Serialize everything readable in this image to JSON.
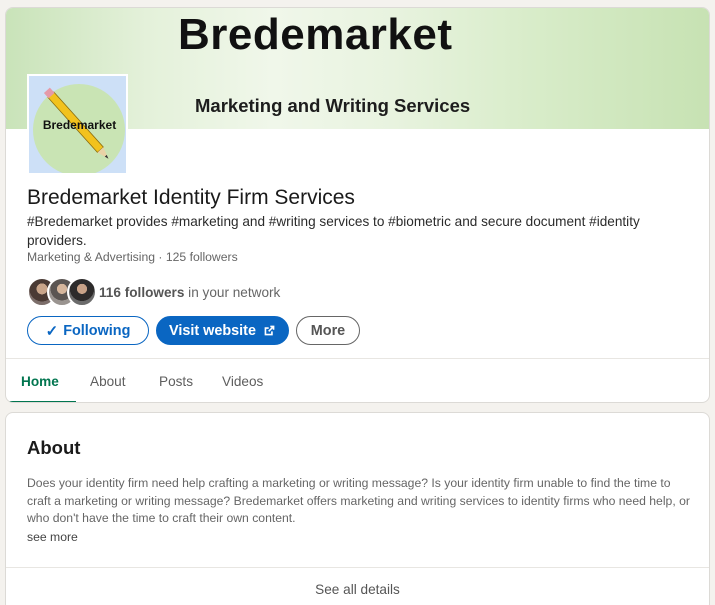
{
  "banner": {
    "title": "Bredemarket",
    "subtitle": "Marketing and Writing Services"
  },
  "logo": {
    "text": "Bredemarket",
    "icon": "pencil-icon"
  },
  "company": {
    "name": "Bredemarket Identity Firm Services",
    "tagline": "#Bredemarket provides #marketing and #writing services to #biometric and secure document #identity providers.",
    "meta": "Marketing & Advertising · 125 followers"
  },
  "network": {
    "followers_count": "116 followers",
    "suffix": " in your network"
  },
  "actions": {
    "following_label": "Following",
    "visit_label": "Visit website",
    "more_label": "More"
  },
  "tabs": [
    {
      "label": "Home",
      "active": true
    },
    {
      "label": "About",
      "active": false
    },
    {
      "label": "Posts",
      "active": false
    },
    {
      "label": "Videos",
      "active": false
    }
  ],
  "about": {
    "title": "About",
    "text": "Does your identity firm need help crafting a marketing or writing message? Is your identity firm unable to find the time to craft a marketing or writing message? Bredemarket offers marketing and writing services to identity firms who need help, or who don't have the time to craft their own content.",
    "see_more": "see more",
    "see_all": "See all details"
  },
  "colors": {
    "brand_blue": "#0a66c2",
    "active_tab_green": "#01754f",
    "page_bg": "#f4f2ee"
  }
}
